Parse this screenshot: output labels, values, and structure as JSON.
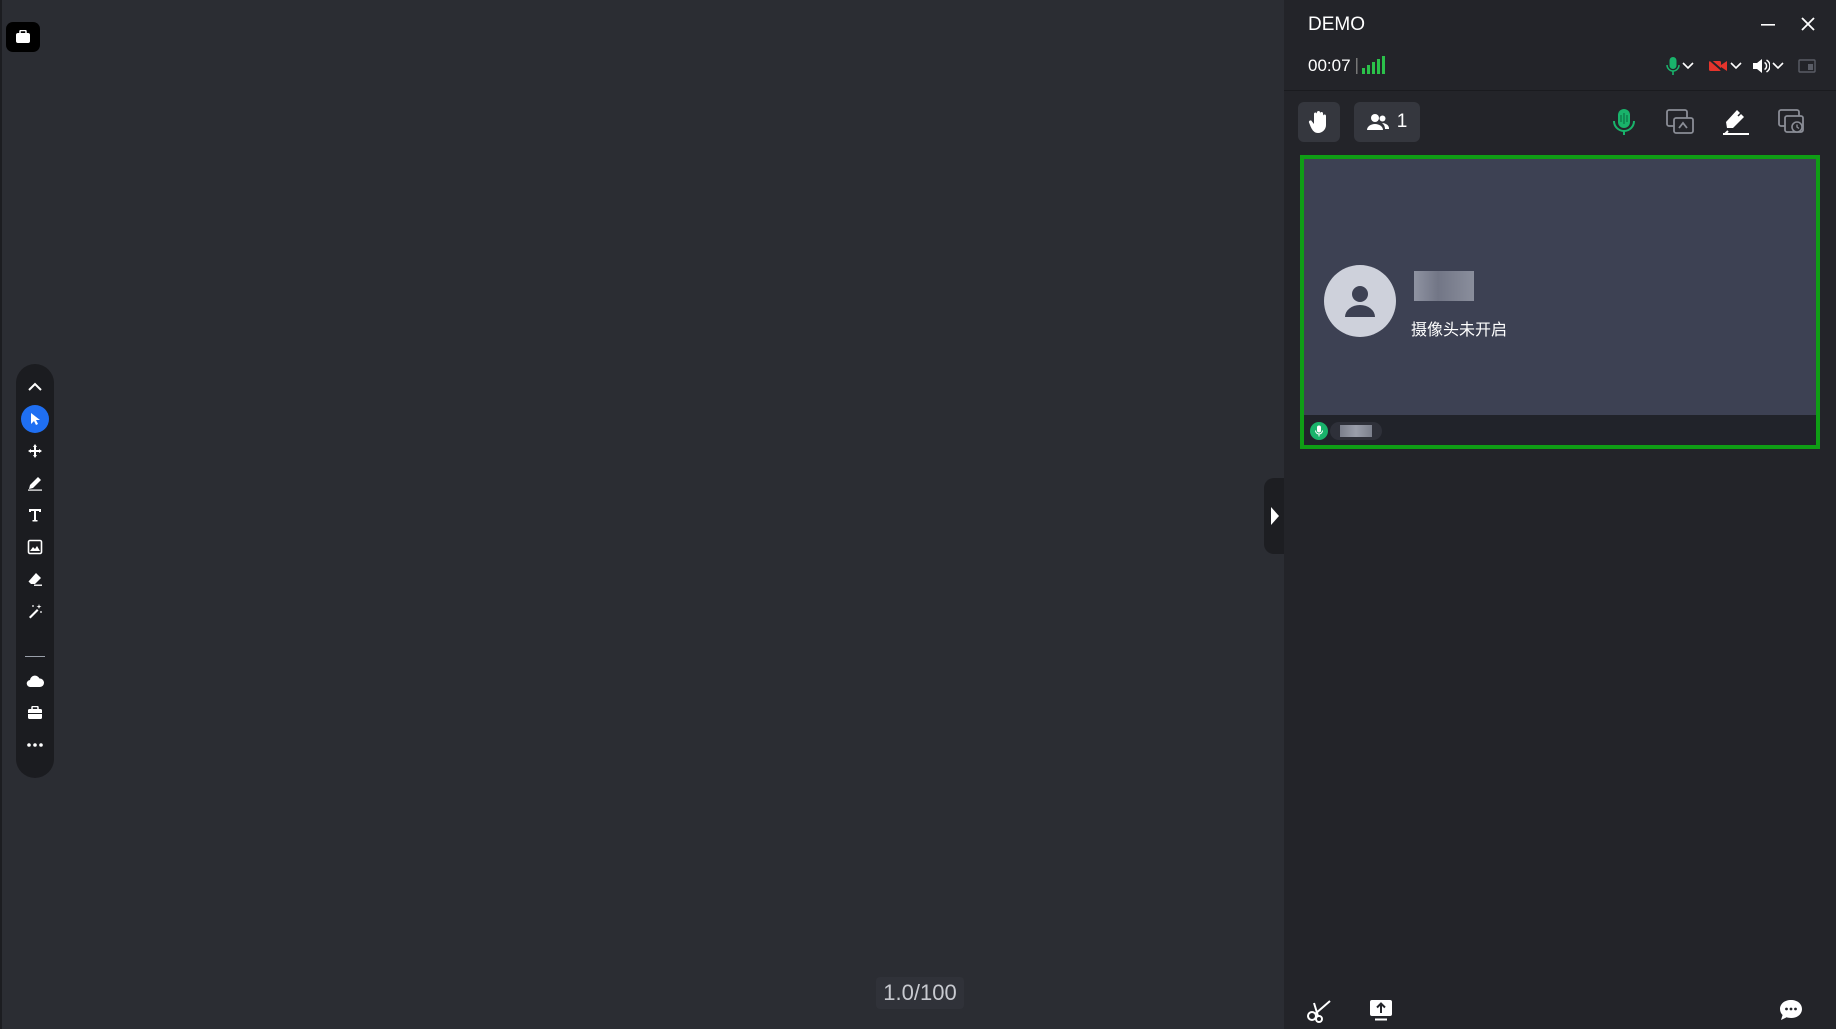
{
  "window": {
    "title": "DEMO"
  },
  "status": {
    "timer": "00:07"
  },
  "members": {
    "count": "1"
  },
  "tile": {
    "camera_off_text": "摄像头未开启"
  },
  "board": {
    "page_indicator": "1.0/100"
  },
  "toolbar": {
    "tools": [
      "collapse-up-icon",
      "select-icon",
      "move-icon",
      "pen-icon",
      "text-icon",
      "image-icon",
      "eraser-icon",
      "magic-wand-icon",
      "cloud-icon",
      "toolbox-icon",
      "more-icon"
    ],
    "active_tool": "select-icon"
  },
  "colors": {
    "accent_blue": "#1f6ff2",
    "speaking_green": "#0f9d15",
    "mic_green": "#19b36b",
    "camera_off_red": "#e5342c",
    "signal_green": "#2bc14a"
  }
}
